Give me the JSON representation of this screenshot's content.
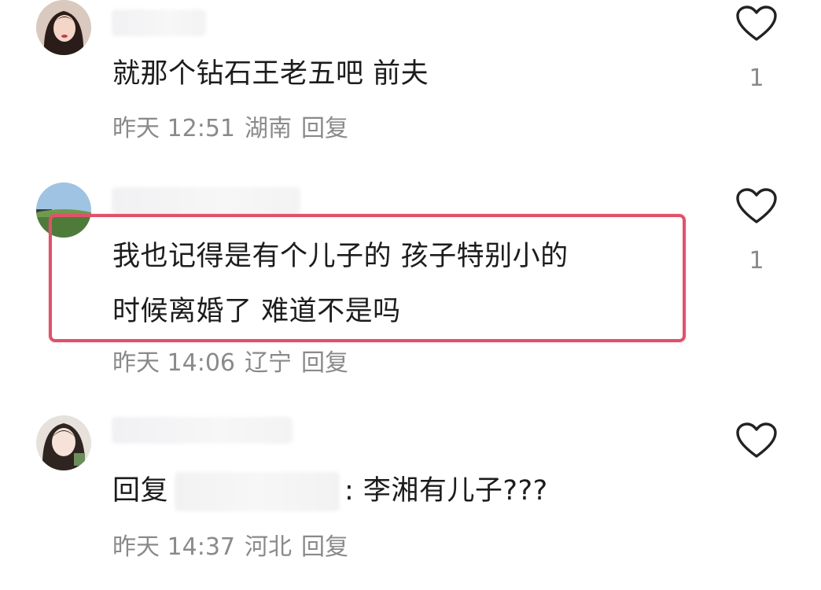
{
  "comments": [
    {
      "text": "就那个钻石王老五吧 前夫",
      "time": "昨天 12:51",
      "location": "湖南",
      "reply_label": "回复",
      "likes": "1"
    },
    {
      "text_line1": "我也记得是有个儿子的 孩子特别小的",
      "text_line2": "时候离婚了 难道不是吗",
      "time": "昨天 14:06",
      "location": "辽宁",
      "reply_label": "回复",
      "likes": "1"
    },
    {
      "reply_prefix": "回复",
      "text": ": 李湘有儿子???",
      "time": "昨天 14:37",
      "location": "河北",
      "reply_label": "回复"
    }
  ],
  "icons": {
    "like": "heart-outline-icon"
  },
  "colors": {
    "highlight_border": "#e0526a",
    "meta_text": "#8a8a8a"
  }
}
